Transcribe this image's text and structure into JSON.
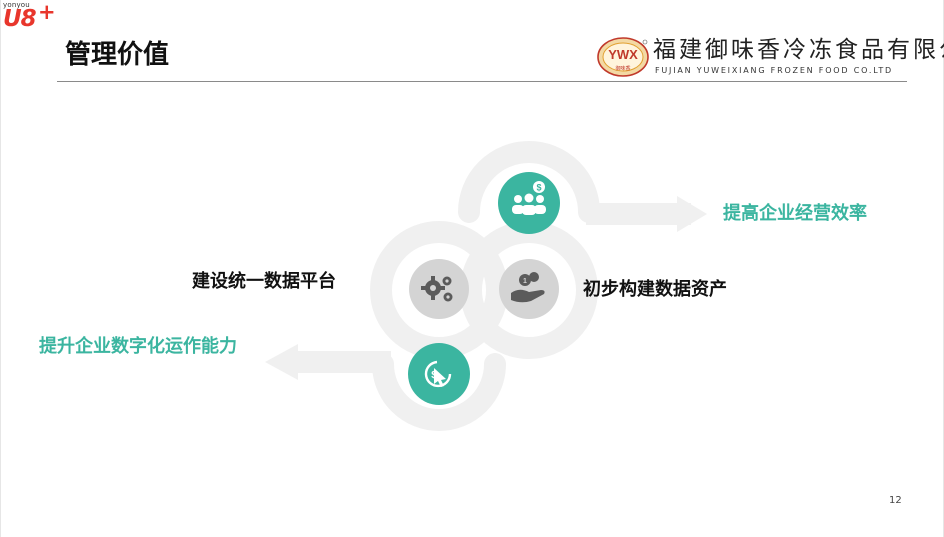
{
  "brand": {
    "small": "yonyou",
    "mark": "U8",
    "plus": "+"
  },
  "slide": {
    "title": "管理价值",
    "page_number": "12"
  },
  "company": {
    "logo_text": "YWX",
    "logo_sub": "御味香",
    "name_cn": "福建御味香冷冻食品有限公司",
    "name_en": "FUJIAN  YUWEIXIANG  FROZEN  FOOD  CO.LTD"
  },
  "diagram": {
    "labels": {
      "top_right": "提高企业经营效率",
      "middle_left": "建设统一数据平台",
      "middle_right": "初步构建数据资产",
      "bottom_left": "提升企业数字化运作能力"
    },
    "icons": {
      "top": "team-dollar-icon",
      "middle_left": "gears-icon",
      "middle_right": "hand-coins-icon",
      "bottom": "dollar-cursor-icon"
    },
    "colors": {
      "teal": "#3bb5a0",
      "gray": "#d0d0d0",
      "track": "#f0f0f0"
    }
  }
}
